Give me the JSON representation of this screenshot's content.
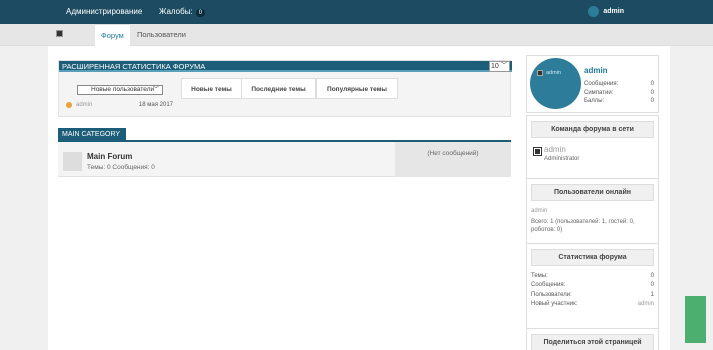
{
  "topbar": {
    "admin_link": "Администрирование",
    "complaints_label": "Жалобы:",
    "complaints_count": "0",
    "user_name": "admin"
  },
  "nav": {
    "tabs": [
      "Форум",
      "Пользователи"
    ],
    "active_tab": "Форум"
  },
  "stats": {
    "title": "РАСШИРЕННАЯ СТАТИСТИКА ФОРУМА",
    "count_select": "10",
    "users_select": "Новые пользователи",
    "tabs": [
      "Новые темы",
      "Последние темы",
      "Популярные темы"
    ],
    "recent_user": "admin",
    "recent_date": "18 мая 2017"
  },
  "category": {
    "title": "MAIN CATEGORY",
    "forum": {
      "name": "Main Forum",
      "meta": "Темы: 0 Сообщения: 0",
      "last_post": "(Нет сообщений)"
    }
  },
  "sidebar": {
    "profile": {
      "avatar_alt": "admin",
      "name": "admin",
      "rows": [
        {
          "label": "Сообщения:",
          "value": "0"
        },
        {
          "label": "Симпатии:",
          "value": "0"
        },
        {
          "label": "Баллы:",
          "value": "0"
        }
      ]
    },
    "team": {
      "title": "Команда форума в сети",
      "member_name": "admin",
      "member_role": "Administrator"
    },
    "online": {
      "title": "Пользователи онлайн",
      "user": "admin",
      "summary": "Всего: 1 (пользователей: 1, гостей: 0, роботов: 0)"
    },
    "forum_stats": {
      "title": "Статистика форума",
      "rows": [
        {
          "label": "Темы:",
          "value": "0"
        },
        {
          "label": "Сообщения:",
          "value": "0"
        },
        {
          "label": "Пользователи:",
          "value": "1"
        },
        {
          "label": "Новый участник:",
          "value": "admin"
        }
      ]
    },
    "share": {
      "title": "Поделиться этой страницей"
    }
  }
}
